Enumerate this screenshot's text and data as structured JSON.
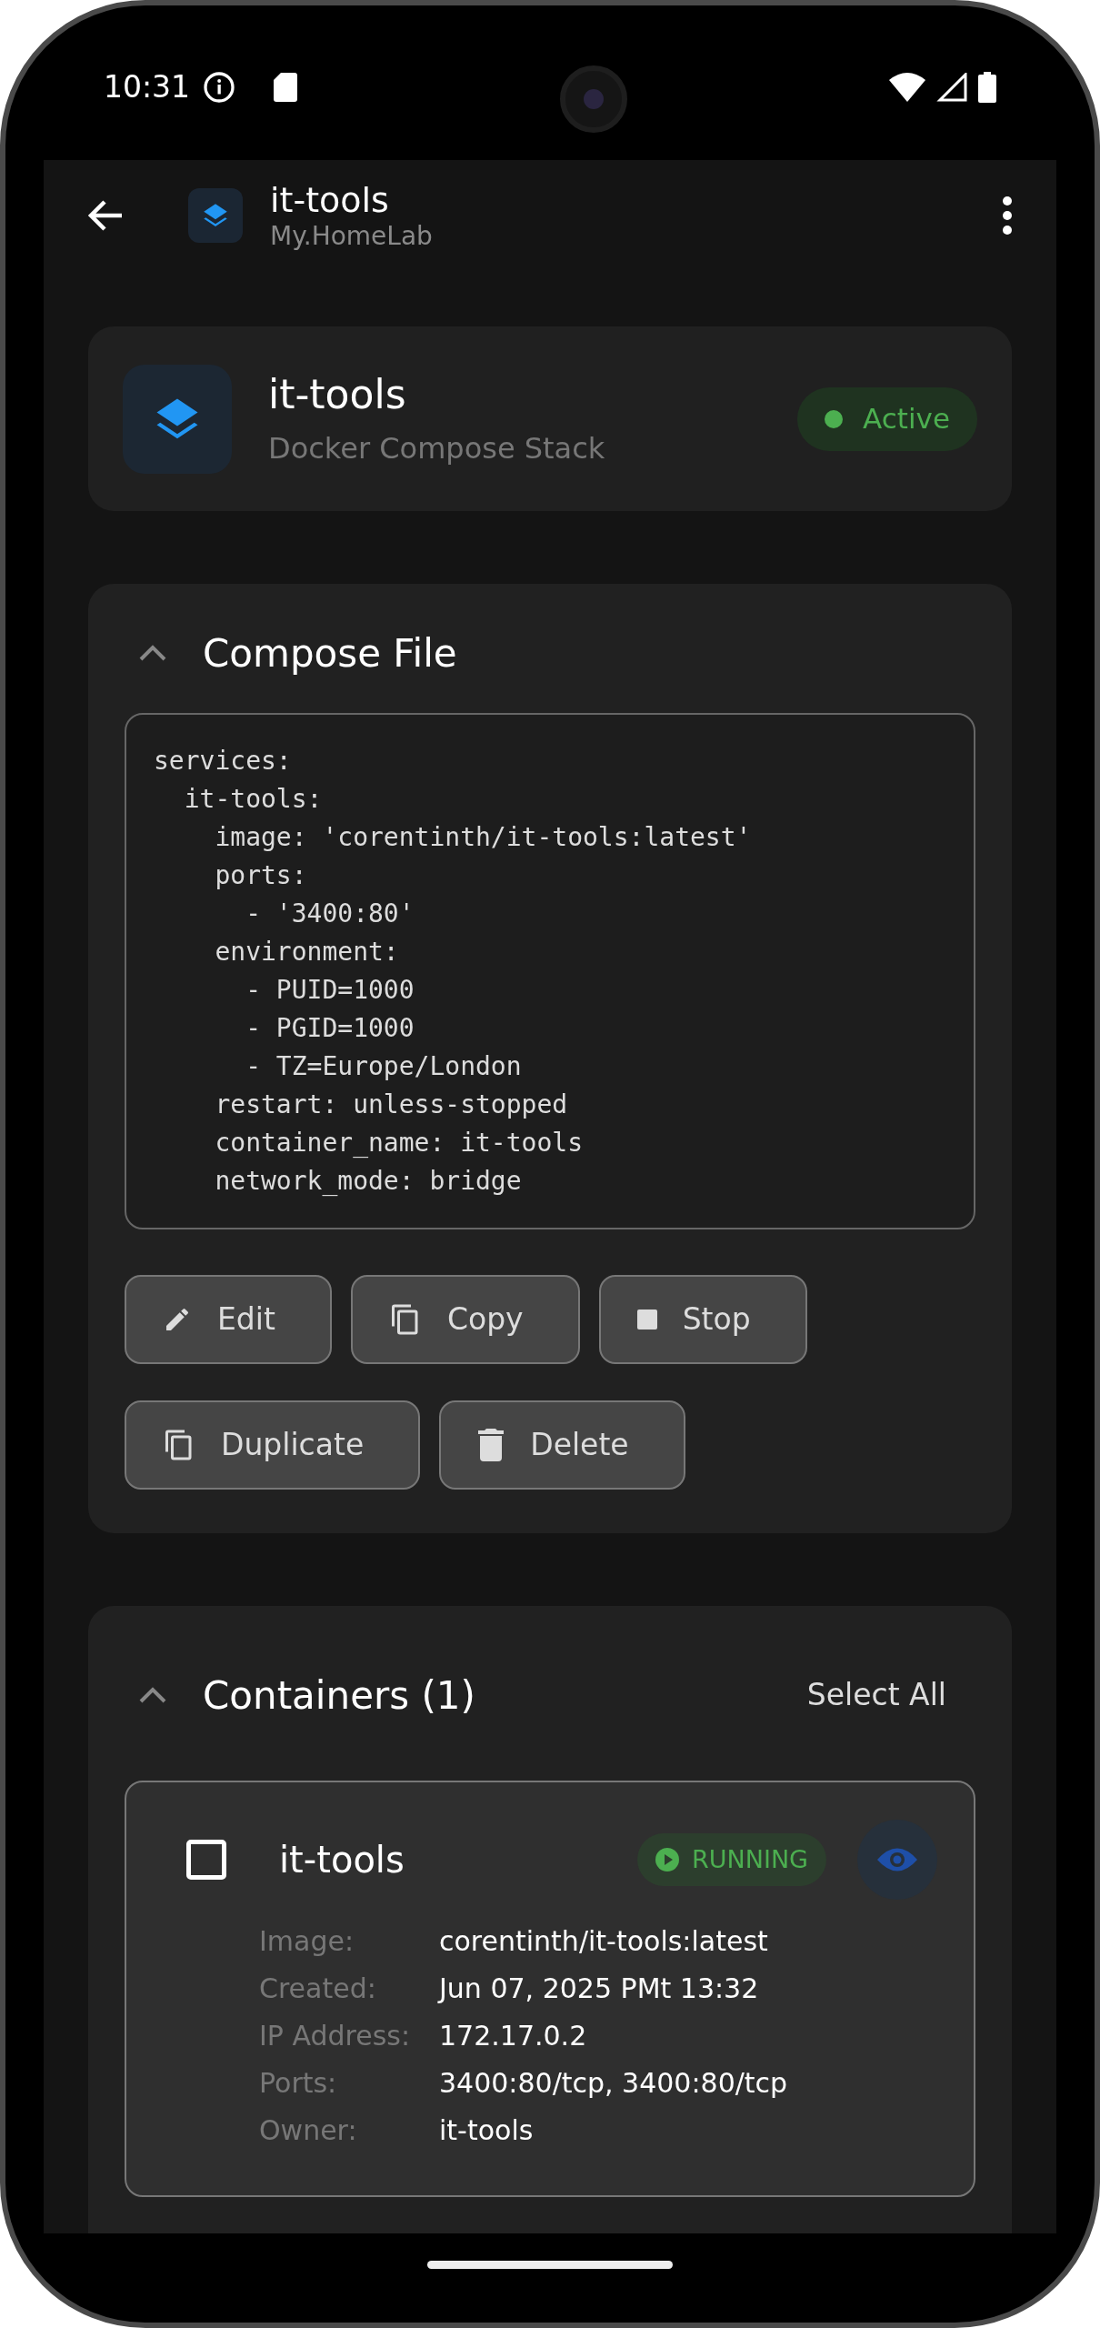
{
  "status_bar": {
    "time": "10:31"
  },
  "app_bar": {
    "title": "it-tools",
    "subtitle": "My.HomeLab"
  },
  "header": {
    "title": "it-tools",
    "subtitle": "Docker Compose Stack",
    "status": {
      "label": "Active",
      "color": "#4caf50"
    }
  },
  "compose": {
    "title": "Compose File",
    "expanded": true,
    "code": "services:\n  it-tools:\n    image: 'corentinth/it-tools:latest'\n    ports:\n      - '3400:80'\n    environment:\n      - PUID=1000\n      - PGID=1000\n      - TZ=Europe/London\n    restart: unless-stopped\n    container_name: it-tools\n    network_mode: bridge",
    "buttons": [
      {
        "label": "Edit",
        "kind": "edit"
      },
      {
        "label": "Copy",
        "kind": "copy"
      },
      {
        "label": "Stop",
        "kind": "stop"
      },
      {
        "label": "Duplicate",
        "kind": "copy"
      },
      {
        "label": "Delete",
        "kind": "delete"
      }
    ]
  },
  "containers": {
    "title": "Containers (1)",
    "expanded": true,
    "action": "Select All",
    "items": [
      {
        "name": "it-tools",
        "checked": false,
        "status": "RUNNING",
        "details": [
          {
            "label": "Image:",
            "value": "corentinth/it-tools:latest"
          },
          {
            "label": "Created:",
            "value": "Jun 07, 2025 PMt 13:32"
          },
          {
            "label": "IP Address:",
            "value": "172.17.0.2"
          },
          {
            "label": "Ports:",
            "value": "3400:80/tcp, 3400:80/tcp"
          },
          {
            "label": "Owner:",
            "value": "it-tools"
          }
        ]
      }
    ]
  }
}
